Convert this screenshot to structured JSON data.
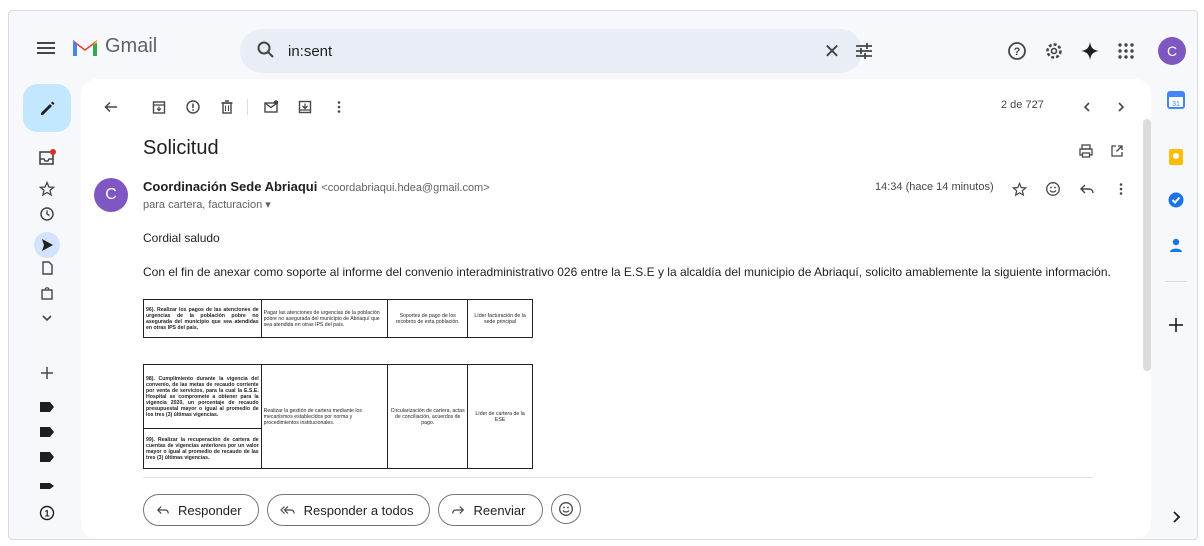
{
  "app": {
    "name": "Gmail",
    "account_initial": "C"
  },
  "search": {
    "query": "in:sent",
    "clear_glyph": "✕"
  },
  "toolbar": {
    "pager": "2 de 727"
  },
  "message": {
    "subject": "Solicitud",
    "sender_initial": "C",
    "sender_name": "Coordinación Sede Abriaqui",
    "sender_email": "<coordabriaqui.hdea@gmail.com>",
    "recipients": "para cartera, facturacion ▾",
    "time": "14:34 (hace 14 minutos)",
    "greeting": "Cordial saludo",
    "paragraph": "Con el fin de anexar como soporte al informe del convenio interadministrativo 026 entre la E.S.E y la alcaldía del municipio de Abriaquí, solicito amablemente la siguiente información."
  },
  "table1": {
    "rows": [
      [
        "96). Realizar los pagos de las atenciones de urgencias de la población pobre no asegurada del municipio que sea atendidas en otras IPS del país.",
        "Pagar las atenciones de urgencias de la población pobre no asegurada del municipio de Abriaquí que sea atendida en otras IPS del país.",
        "Soportes de pago de los recobros de esta población.",
        "Líder facturación de la sede principal"
      ]
    ]
  },
  "table2": {
    "rows": [
      [
        "98). Cumplimiento durante la vigencia del convenio, de las metas de recaudo corriente por venta de servicios, para la cual la E.S.E. Hospital se compromete a obtener para la vigencia 2020, un porcentaje de recaudo presupuestal mayor o igual al promedio de los tres (3) últimas vigencias.",
        "Realizar la gestión de cartera mediante los mecanismos establecidos por norma y procedimientos institucionales.",
        "Circularización de cartera, actas de conciliación, acuerdos de pago.",
        "Líder de cartera de la ESE"
      ],
      [
        "99). Realizar la recuperación de cartera de cuentas de vigencias anteriores por un valor mayor o igual al promedio de recaudo de las tres (3) últimas vigencias."
      ]
    ]
  },
  "reply": {
    "reply_label": "Responder",
    "reply_all_label": "Responder a todos",
    "forward_label": "Reenviar"
  },
  "icons": [
    "menu-icon",
    "search-icon",
    "clear-icon",
    "tune-icon",
    "help-icon",
    "settings-icon",
    "gemini-icon",
    "apps-icon",
    "compose-icon",
    "inbox-icon",
    "star-icon",
    "snoozed-icon",
    "sent-icon",
    "drafts-icon",
    "purchases-icon",
    "more-icon",
    "add-label-icon",
    "label-icon",
    "back-icon",
    "archive-icon",
    "report-spam-icon",
    "delete-icon",
    "mark-unread-icon",
    "move-to-icon",
    "more-vert-icon",
    "prev-icon",
    "next-icon",
    "print-icon",
    "open-new-window-icon",
    "emoji-icon",
    "reply-icon",
    "calendar-icon",
    "keep-icon",
    "tasks-icon",
    "contacts-icon",
    "add-addon-icon",
    "expand-panel-icon"
  ],
  "colors": {
    "accent": "#0b57d0",
    "compose": "#c2e7ff",
    "avatar": "#7e57c2",
    "background": "#f6f8fc"
  }
}
